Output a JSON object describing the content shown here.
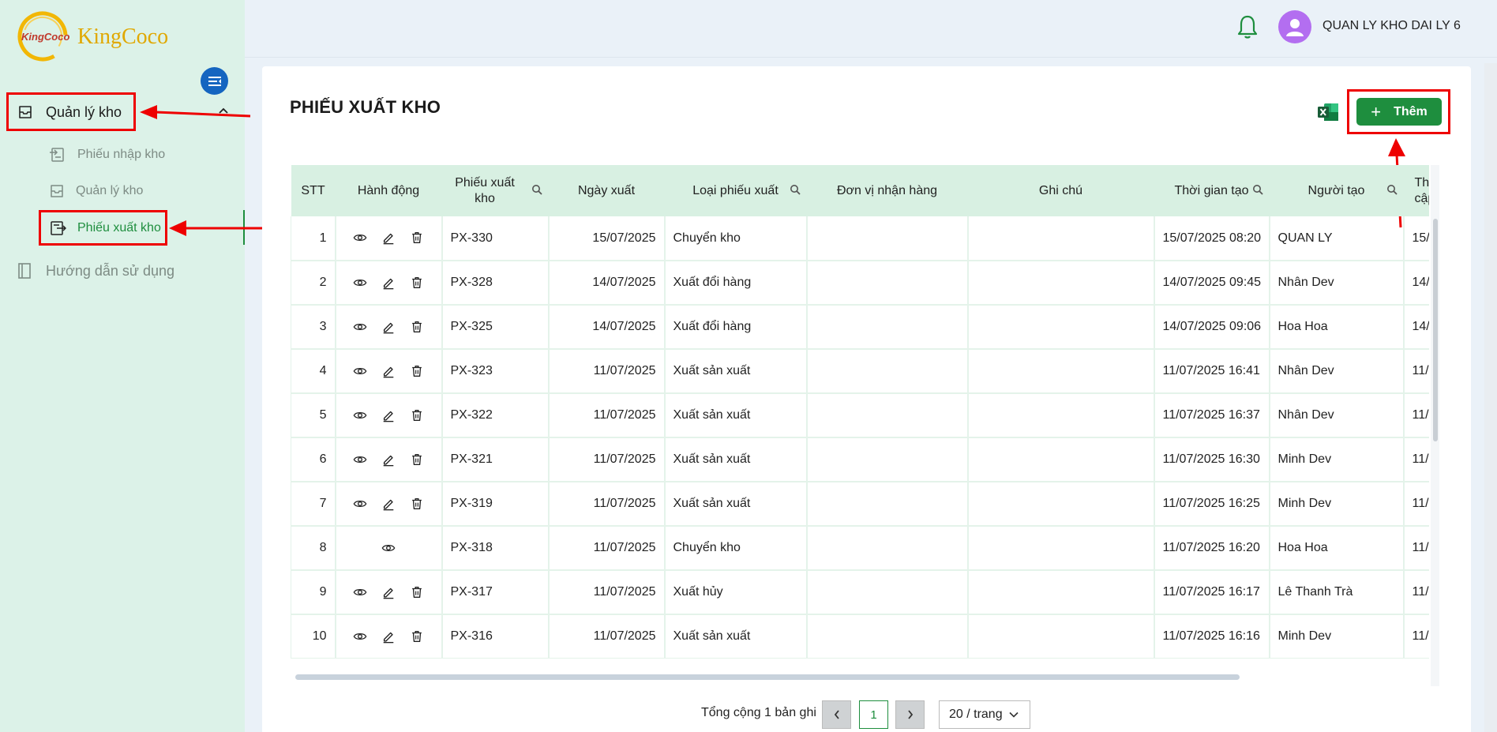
{
  "app": {
    "logo_text": "KingCoco",
    "logo_mark_text": "KingCoco"
  },
  "sidebar": {
    "group_label": "Quản lý kho",
    "items": [
      {
        "label": "Phiếu nhập kho",
        "icon": "import-icon"
      },
      {
        "label": "Quản lý kho",
        "icon": "box-icon"
      },
      {
        "label": "Phiếu xuất kho",
        "icon": "export-icon",
        "active": true
      }
    ],
    "guide_label": "Hướng dẫn sử dụng"
  },
  "header": {
    "username": "QUAN LY KHO DAI LY 6"
  },
  "page": {
    "title": "PHIẾU XUẤT KHO",
    "add_label": "Thêm"
  },
  "table": {
    "columns": [
      "STT",
      "Hành động",
      "Phiếu xuất kho",
      "Ngày xuất",
      "Loại phiếu xuất",
      "Đơn vị nhận hàng",
      "Ghi chú",
      "Thời gian tạo",
      "Người tạo",
      "Thời gian cập nhật"
    ],
    "rows": [
      {
        "stt": "1",
        "actions": [
          "view",
          "edit",
          "delete"
        ],
        "code": "PX-330",
        "date": "15/07/2025",
        "type": "Chuyển kho",
        "receiver": "",
        "note": "",
        "created": "15/07/2025 08:20",
        "creator": "QUAN LY",
        "updated": "15/"
      },
      {
        "stt": "2",
        "actions": [
          "view",
          "edit",
          "delete"
        ],
        "code": "PX-328",
        "date": "14/07/2025",
        "type": "Xuất đổi hàng",
        "receiver": "",
        "note": "",
        "created": "14/07/2025 09:45",
        "creator": "Nhân Dev",
        "updated": "14/"
      },
      {
        "stt": "3",
        "actions": [
          "view",
          "edit",
          "delete"
        ],
        "code": "PX-325",
        "date": "14/07/2025",
        "type": "Xuất đổi hàng",
        "receiver": "",
        "note": "",
        "created": "14/07/2025 09:06",
        "creator": "Hoa Hoa",
        "updated": "14/"
      },
      {
        "stt": "4",
        "actions": [
          "view",
          "edit",
          "delete"
        ],
        "code": "PX-323",
        "date": "11/07/2025",
        "type": "Xuất sản xuất",
        "receiver": "",
        "note": "",
        "created": "11/07/2025 16:41",
        "creator": "Nhân Dev",
        "updated": "11/"
      },
      {
        "stt": "5",
        "actions": [
          "view",
          "edit",
          "delete"
        ],
        "code": "PX-322",
        "date": "11/07/2025",
        "type": "Xuất sản xuất",
        "receiver": "",
        "note": "",
        "created": "11/07/2025 16:37",
        "creator": "Nhân Dev",
        "updated": "11/"
      },
      {
        "stt": "6",
        "actions": [
          "view",
          "edit",
          "delete"
        ],
        "code": "PX-321",
        "date": "11/07/2025",
        "type": "Xuất sản xuất",
        "receiver": "",
        "note": "",
        "created": "11/07/2025 16:30",
        "creator": "Minh Dev",
        "updated": "11/"
      },
      {
        "stt": "7",
        "actions": [
          "view",
          "edit",
          "delete"
        ],
        "code": "PX-319",
        "date": "11/07/2025",
        "type": "Xuất sản xuất",
        "receiver": "",
        "note": "",
        "created": "11/07/2025 16:25",
        "creator": "Minh Dev",
        "updated": "11/"
      },
      {
        "stt": "8",
        "actions": [
          "view"
        ],
        "code": "PX-318",
        "date": "11/07/2025",
        "type": "Chuyển kho",
        "receiver": "",
        "note": "",
        "created": "11/07/2025 16:20",
        "creator": "Hoa Hoa",
        "updated": "11/"
      },
      {
        "stt": "9",
        "actions": [
          "view",
          "edit",
          "delete"
        ],
        "code": "PX-317",
        "date": "11/07/2025",
        "type": "Xuất hủy",
        "receiver": "",
        "note": "",
        "created": "11/07/2025 16:17",
        "creator": "Lê Thanh Trà",
        "updated": "11/"
      },
      {
        "stt": "10",
        "actions": [
          "view",
          "edit",
          "delete"
        ],
        "code": "PX-316",
        "date": "11/07/2025",
        "type": "Xuất sản xuất",
        "receiver": "",
        "note": "",
        "created": "11/07/2025 16:16",
        "creator": "Minh Dev",
        "updated": "11/"
      }
    ]
  },
  "pagination": {
    "total_text": "Tổng cộng 1 bản ghi",
    "current": "1",
    "page_size": "20 / trang"
  },
  "colors": {
    "primary_green": "#1e8e3e",
    "sidebar_bg": "#dcf2e8",
    "header_row": "#d8f0e2",
    "annotation_red": "#ee0000",
    "avatar": "#b36ef0"
  }
}
